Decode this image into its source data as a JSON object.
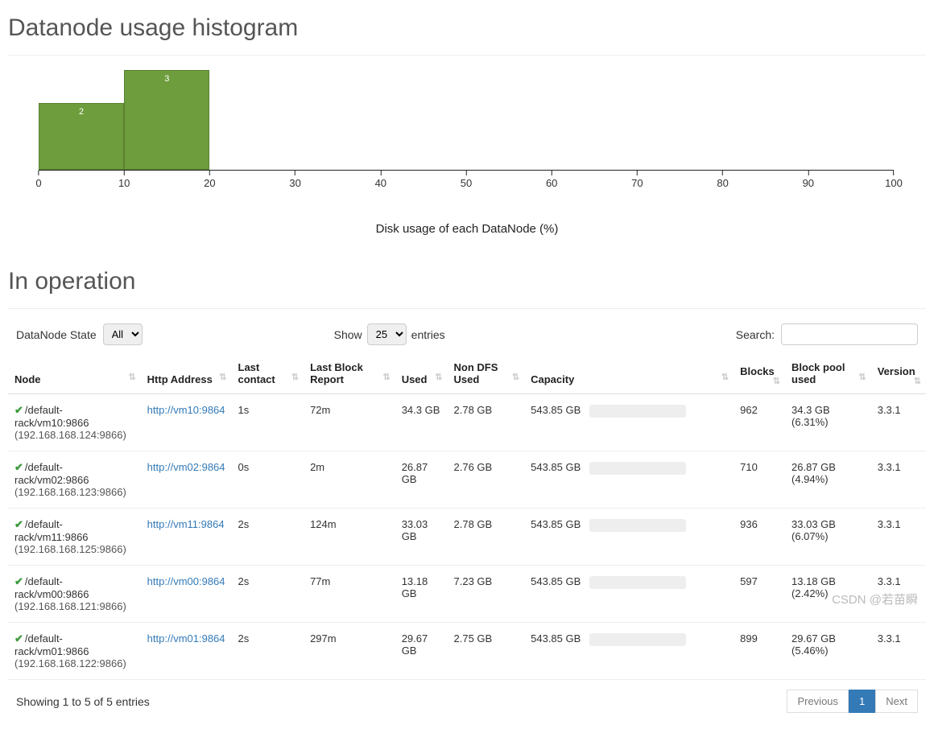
{
  "sections": {
    "histogram_title": "Datanode usage histogram",
    "in_operation_title": "In operation"
  },
  "chart_data": {
    "type": "bar",
    "categories": [
      0,
      10,
      20,
      30,
      40,
      50,
      60,
      70,
      80,
      90,
      100
    ],
    "values": [
      2,
      3,
      0,
      0,
      0,
      0,
      0,
      0,
      0,
      0
    ],
    "xlabel": "Disk usage of each DataNode (%)",
    "ylim": [
      0,
      3
    ]
  },
  "controls": {
    "state_label": "DataNode State",
    "state_value": "All",
    "show_label": "Show",
    "show_value": "25",
    "entries_label": "entries",
    "search_label": "Search:",
    "search_value": ""
  },
  "columns": [
    "Node",
    "Http Address",
    "Last contact",
    "Last Block Report",
    "Used",
    "Non DFS Used",
    "Capacity",
    "Blocks",
    "Block pool used",
    "Version"
  ],
  "rows": [
    {
      "node": "/default-rack/vm10:9866",
      "ip": "(192.168.168.124:9866)",
      "http": "http://vm10:9864",
      "last_contact": "1s",
      "last_block": "72m",
      "used": "34.3 GB",
      "nondfs": "2.78 GB",
      "capacity": "543.85 GB",
      "cap_pct": 6.31,
      "blocks": "962",
      "bp_used": "34.3 GB (6.31%)",
      "version": "3.3.1"
    },
    {
      "node": "/default-rack/vm02:9866",
      "ip": "(192.168.168.123:9866)",
      "http": "http://vm02:9864",
      "last_contact": "0s",
      "last_block": "2m",
      "used": "26.87 GB",
      "nondfs": "2.76 GB",
      "capacity": "543.85 GB",
      "cap_pct": 4.94,
      "blocks": "710",
      "bp_used": "26.87 GB (4.94%)",
      "version": "3.3.1"
    },
    {
      "node": "/default-rack/vm11:9866",
      "ip": "(192.168.168.125:9866)",
      "http": "http://vm11:9864",
      "last_contact": "2s",
      "last_block": "124m",
      "used": "33.03 GB",
      "nondfs": "2.78 GB",
      "capacity": "543.85 GB",
      "cap_pct": 6.07,
      "blocks": "936",
      "bp_used": "33.03 GB (6.07%)",
      "version": "3.3.1"
    },
    {
      "node": "/default-rack/vm00:9866",
      "ip": "(192.168.168.121:9866)",
      "http": "http://vm00:9864",
      "last_contact": "2s",
      "last_block": "77m",
      "used": "13.18 GB",
      "nondfs": "7.23 GB",
      "capacity": "543.85 GB",
      "cap_pct": 2.42,
      "blocks": "597",
      "bp_used": "13.18 GB (2.42%)",
      "version": "3.3.1"
    },
    {
      "node": "/default-rack/vm01:9866",
      "ip": "(192.168.168.122:9866)",
      "http": "http://vm01:9864",
      "last_contact": "2s",
      "last_block": "297m",
      "used": "29.67 GB",
      "nondfs": "2.75 GB",
      "capacity": "543.85 GB",
      "cap_pct": 5.46,
      "blocks": "899",
      "bp_used": "29.67 GB (5.46%)",
      "version": "3.3.1"
    }
  ],
  "footer": {
    "info": "Showing 1 to 5 of 5 entries",
    "prev": "Previous",
    "page": "1",
    "next": "Next"
  },
  "watermark": "CSDN @若苗瞬"
}
